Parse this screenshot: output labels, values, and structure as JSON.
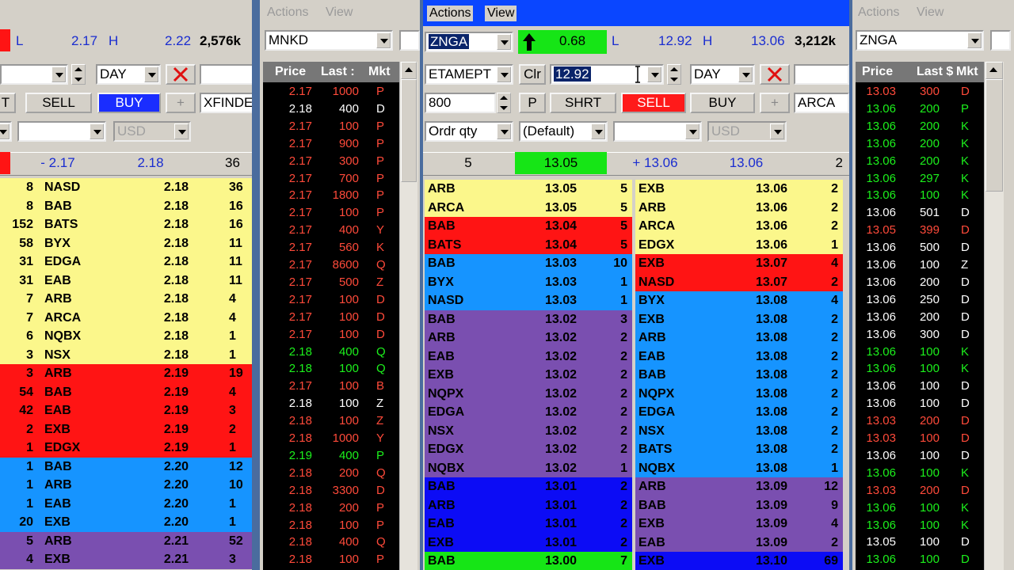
{
  "left_panel": {
    "low_label": "L",
    "low_value": "2.17",
    "high_label": "H",
    "high_value": "2.22",
    "volume": "2,576k",
    "duration": "DAY",
    "sell_label": "SELL",
    "buy_label": "BUY",
    "plus_label": "+",
    "route": "XFINDE",
    "left_btn_partial": "T",
    "currency": "USD",
    "summary": {
      "bid_change": "- 2.17",
      "ask": "2.18",
      "ask_size": "36"
    },
    "bids": [
      {
        "size": "8",
        "mm": "NASD",
        "price": "2.18",
        "ask_size": "36",
        "color": "yellow"
      },
      {
        "size": "8",
        "mm": "BAB",
        "price": "2.18",
        "ask_size": "16",
        "color": "yellow"
      },
      {
        "size": "152",
        "mm": "BATS",
        "price": "2.18",
        "ask_size": "16",
        "color": "yellow"
      },
      {
        "size": "58",
        "mm": "BYX",
        "price": "2.18",
        "ask_size": "11",
        "color": "yellow"
      },
      {
        "size": "31",
        "mm": "EDGA",
        "price": "2.18",
        "ask_size": "11",
        "color": "yellow"
      },
      {
        "size": "31",
        "mm": "EAB",
        "price": "2.18",
        "ask_size": "11",
        "color": "yellow"
      },
      {
        "size": "7",
        "mm": "ARB",
        "price": "2.18",
        "ask_size": "4",
        "color": "yellow"
      },
      {
        "size": "7",
        "mm": "ARCA",
        "price": "2.18",
        "ask_size": "4",
        "color": "yellow"
      },
      {
        "size": "6",
        "mm": "NQBX",
        "price": "2.18",
        "ask_size": "1",
        "color": "yellow"
      },
      {
        "size": "3",
        "mm": "NSX",
        "price": "2.18",
        "ask_size": "1",
        "color": "yellow"
      },
      {
        "size": "3",
        "mm": "ARB",
        "price": "2.19",
        "ask_size": "19",
        "color": "red"
      },
      {
        "size": "54",
        "mm": "BAB",
        "price": "2.19",
        "ask_size": "4",
        "color": "red"
      },
      {
        "size": "42",
        "mm": "EAB",
        "price": "2.19",
        "ask_size": "3",
        "color": "red"
      },
      {
        "size": "2",
        "mm": "EXB",
        "price": "2.19",
        "ask_size": "2",
        "color": "red"
      },
      {
        "size": "1",
        "mm": "EDGX",
        "price": "2.19",
        "ask_size": "1",
        "color": "red"
      },
      {
        "size": "1",
        "mm": "BAB",
        "price": "2.20",
        "ask_size": "12",
        "color": "blue"
      },
      {
        "size": "1",
        "mm": "ARB",
        "price": "2.20",
        "ask_size": "10",
        "color": "blue"
      },
      {
        "size": "1",
        "mm": "EAB",
        "price": "2.20",
        "ask_size": "1",
        "color": "blue"
      },
      {
        "size": "20",
        "mm": "EXB",
        "price": "2.20",
        "ask_size": "1",
        "color": "blue"
      },
      {
        "size": "5",
        "mm": "ARB",
        "price": "2.21",
        "ask_size": "52",
        "color": "purple"
      },
      {
        "size": "4",
        "mm": "EXB",
        "price": "2.21",
        "ask_size": "3",
        "color": "purple"
      }
    ]
  },
  "mnkd_tape": {
    "menu": {
      "actions": "Actions",
      "view": "View"
    },
    "symbol": "MNKD",
    "headers": {
      "price": "Price",
      "last": "Last :",
      "mkt": "Mkt"
    },
    "rows": [
      {
        "price": "2.17",
        "size": "1000",
        "mkt": "P",
        "c": "red"
      },
      {
        "price": "2.18",
        "size": "400",
        "mkt": "D",
        "c": "white"
      },
      {
        "price": "2.17",
        "size": "100",
        "mkt": "P",
        "c": "red"
      },
      {
        "price": "2.17",
        "size": "900",
        "mkt": "P",
        "c": "red"
      },
      {
        "price": "2.17",
        "size": "300",
        "mkt": "P",
        "c": "red"
      },
      {
        "price": "2.17",
        "size": "700",
        "mkt": "P",
        "c": "red"
      },
      {
        "price": "2.17",
        "size": "1800",
        "mkt": "P",
        "c": "red"
      },
      {
        "price": "2.17",
        "size": "100",
        "mkt": "P",
        "c": "red"
      },
      {
        "price": "2.17",
        "size": "400",
        "mkt": "Y",
        "c": "red"
      },
      {
        "price": "2.17",
        "size": "560",
        "mkt": "K",
        "c": "red"
      },
      {
        "price": "2.17",
        "size": "8600",
        "mkt": "Q",
        "c": "red"
      },
      {
        "price": "2.17",
        "size": "500",
        "mkt": "Z",
        "c": "red"
      },
      {
        "price": "2.17",
        "size": "100",
        "mkt": "D",
        "c": "red"
      },
      {
        "price": "2.17",
        "size": "100",
        "mkt": "D",
        "c": "red"
      },
      {
        "price": "2.17",
        "size": "100",
        "mkt": "D",
        "c": "red"
      },
      {
        "price": "2.18",
        "size": "400",
        "mkt": "Q",
        "c": "green"
      },
      {
        "price": "2.18",
        "size": "100",
        "mkt": "Q",
        "c": "green"
      },
      {
        "price": "2.17",
        "size": "100",
        "mkt": "B",
        "c": "red"
      },
      {
        "price": "2.18",
        "size": "100",
        "mkt": "Z",
        "c": "white"
      },
      {
        "price": "2.18",
        "size": "100",
        "mkt": "Z",
        "c": "red"
      },
      {
        "price": "2.18",
        "size": "1000",
        "mkt": "Y",
        "c": "red"
      },
      {
        "price": "2.19",
        "size": "400",
        "mkt": "P",
        "c": "green"
      },
      {
        "price": "2.18",
        "size": "200",
        "mkt": "Q",
        "c": "red"
      },
      {
        "price": "2.18",
        "size": "3300",
        "mkt": "D",
        "c": "red"
      },
      {
        "price": "2.18",
        "size": "200",
        "mkt": "P",
        "c": "red"
      },
      {
        "price": "2.18",
        "size": "100",
        "mkt": "P",
        "c": "red"
      },
      {
        "price": "2.18",
        "size": "400",
        "mkt": "Q",
        "c": "red"
      },
      {
        "price": "2.18",
        "size": "100",
        "mkt": "P",
        "c": "red"
      }
    ]
  },
  "znga_l2": {
    "menu": {
      "actions": "Actions",
      "view": "View"
    },
    "symbol": "ZNGA",
    "change": "0.68",
    "low_label": "L",
    "low_value": "12.92",
    "high_label": "H",
    "high_value": "13.06",
    "volume": "3,212k",
    "order_type": "ETAMEPT",
    "clr_label": "Clr",
    "price_input": "12.92",
    "duration": "DAY",
    "quantity": "800",
    "p_label": "P",
    "shrt_label": "SHRT",
    "sell_label": "SELL",
    "buy_label": "BUY",
    "plus_label": "+",
    "route": "ARCA",
    "qty_mode": "Ordr qty",
    "account": "(Default)",
    "currency": "USD",
    "summary": {
      "bid_size": "5",
      "bid": "13.05",
      "ask_change": "+ 13.06",
      "ask": "13.06",
      "ask_size": "2"
    },
    "bids": [
      {
        "mm": "ARB",
        "price": "13.05",
        "size": "5",
        "color": "yellow"
      },
      {
        "mm": "ARCA",
        "price": "13.05",
        "size": "5",
        "color": "yellow"
      },
      {
        "mm": "BAB",
        "price": "13.04",
        "size": "5",
        "color": "red"
      },
      {
        "mm": "BATS",
        "price": "13.04",
        "size": "5",
        "color": "red"
      },
      {
        "mm": "BAB",
        "price": "13.03",
        "size": "10",
        "color": "blue"
      },
      {
        "mm": "BYX",
        "price": "13.03",
        "size": "1",
        "color": "blue"
      },
      {
        "mm": "NASD",
        "price": "13.03",
        "size": "1",
        "color": "blue"
      },
      {
        "mm": "BAB",
        "price": "13.02",
        "size": "3",
        "color": "purple"
      },
      {
        "mm": "ARB",
        "price": "13.02",
        "size": "2",
        "color": "purple"
      },
      {
        "mm": "EAB",
        "price": "13.02",
        "size": "2",
        "color": "purple"
      },
      {
        "mm": "EXB",
        "price": "13.02",
        "size": "2",
        "color": "purple"
      },
      {
        "mm": "NQPX",
        "price": "13.02",
        "size": "2",
        "color": "purple"
      },
      {
        "mm": "EDGA",
        "price": "13.02",
        "size": "2",
        "color": "purple"
      },
      {
        "mm": "NSX",
        "price": "13.02",
        "size": "2",
        "color": "purple"
      },
      {
        "mm": "EDGX",
        "price": "13.02",
        "size": "2",
        "color": "purple"
      },
      {
        "mm": "NQBX",
        "price": "13.02",
        "size": "1",
        "color": "purple"
      },
      {
        "mm": "BAB",
        "price": "13.01",
        "size": "2",
        "color": "darkblue"
      },
      {
        "mm": "ARB",
        "price": "13.01",
        "size": "2",
        "color": "darkblue"
      },
      {
        "mm": "EAB",
        "price": "13.01",
        "size": "2",
        "color": "darkblue"
      },
      {
        "mm": "EXB",
        "price": "13.01",
        "size": "2",
        "color": "darkblue"
      },
      {
        "mm": "BAB",
        "price": "13.00",
        "size": "7",
        "color": "green"
      }
    ],
    "asks": [
      {
        "mm": "EXB",
        "price": "13.06",
        "size": "2",
        "color": "yellow"
      },
      {
        "mm": "ARB",
        "price": "13.06",
        "size": "2",
        "color": "yellow"
      },
      {
        "mm": "ARCA",
        "price": "13.06",
        "size": "2",
        "color": "yellow"
      },
      {
        "mm": "EDGX",
        "price": "13.06",
        "size": "1",
        "color": "yellow"
      },
      {
        "mm": "EXB",
        "price": "13.07",
        "size": "4",
        "color": "red"
      },
      {
        "mm": "NASD",
        "price": "13.07",
        "size": "2",
        "color": "red"
      },
      {
        "mm": "BYX",
        "price": "13.08",
        "size": "4",
        "color": "blue"
      },
      {
        "mm": "EXB",
        "price": "13.08",
        "size": "2",
        "color": "blue"
      },
      {
        "mm": "ARB",
        "price": "13.08",
        "size": "2",
        "color": "blue"
      },
      {
        "mm": "EAB",
        "price": "13.08",
        "size": "2",
        "color": "blue"
      },
      {
        "mm": "BAB",
        "price": "13.08",
        "size": "2",
        "color": "blue"
      },
      {
        "mm": "NQPX",
        "price": "13.08",
        "size": "2",
        "color": "blue"
      },
      {
        "mm": "EDGA",
        "price": "13.08",
        "size": "2",
        "color": "blue"
      },
      {
        "mm": "NSX",
        "price": "13.08",
        "size": "2",
        "color": "blue"
      },
      {
        "mm": "BATS",
        "price": "13.08",
        "size": "2",
        "color": "blue"
      },
      {
        "mm": "NQBX",
        "price": "13.08",
        "size": "1",
        "color": "blue"
      },
      {
        "mm": "ARB",
        "price": "13.09",
        "size": "12",
        "color": "purple"
      },
      {
        "mm": "BAB",
        "price": "13.09",
        "size": "9",
        "color": "purple"
      },
      {
        "mm": "EXB",
        "price": "13.09",
        "size": "4",
        "color": "purple"
      },
      {
        "mm": "EAB",
        "price": "13.09",
        "size": "2",
        "color": "purple"
      },
      {
        "mm": "EXB",
        "price": "13.10",
        "size": "69",
        "color": "darkblue"
      }
    ]
  },
  "znga_tape": {
    "menu": {
      "actions": "Actions",
      "view": "View"
    },
    "symbol": "ZNGA",
    "headers": {
      "price": "Price",
      "last": "Last $",
      "mkt": "Mkt"
    },
    "rows": [
      {
        "price": "13.03",
        "size": "300",
        "mkt": "D",
        "c": "red"
      },
      {
        "price": "13.06",
        "size": "200",
        "mkt": "P",
        "c": "green"
      },
      {
        "price": "13.06",
        "size": "200",
        "mkt": "K",
        "c": "green"
      },
      {
        "price": "13.06",
        "size": "200",
        "mkt": "K",
        "c": "green"
      },
      {
        "price": "13.06",
        "size": "200",
        "mkt": "K",
        "c": "green"
      },
      {
        "price": "13.06",
        "size": "297",
        "mkt": "K",
        "c": "green"
      },
      {
        "price": "13.06",
        "size": "100",
        "mkt": "K",
        "c": "green"
      },
      {
        "price": "13.06",
        "size": "501",
        "mkt": "D",
        "c": "white"
      },
      {
        "price": "13.05",
        "size": "399",
        "mkt": "D",
        "c": "red"
      },
      {
        "price": "13.06",
        "size": "500",
        "mkt": "D",
        "c": "white"
      },
      {
        "price": "13.06",
        "size": "100",
        "mkt": "Z",
        "c": "white"
      },
      {
        "price": "13.06",
        "size": "200",
        "mkt": "D",
        "c": "white"
      },
      {
        "price": "13.06",
        "size": "250",
        "mkt": "D",
        "c": "white"
      },
      {
        "price": "13.06",
        "size": "200",
        "mkt": "D",
        "c": "white"
      },
      {
        "price": "13.06",
        "size": "300",
        "mkt": "D",
        "c": "white"
      },
      {
        "price": "13.06",
        "size": "100",
        "mkt": "K",
        "c": "green"
      },
      {
        "price": "13.06",
        "size": "100",
        "mkt": "K",
        "c": "green"
      },
      {
        "price": "13.06",
        "size": "100",
        "mkt": "D",
        "c": "white"
      },
      {
        "price": "13.06",
        "size": "100",
        "mkt": "D",
        "c": "white"
      },
      {
        "price": "13.03",
        "size": "200",
        "mkt": "D",
        "c": "red"
      },
      {
        "price": "13.03",
        "size": "100",
        "mkt": "D",
        "c": "red"
      },
      {
        "price": "13.06",
        "size": "100",
        "mkt": "D",
        "c": "white"
      },
      {
        "price": "13.06",
        "size": "100",
        "mkt": "K",
        "c": "green"
      },
      {
        "price": "13.03",
        "size": "200",
        "mkt": "D",
        "c": "red"
      },
      {
        "price": "13.06",
        "size": "100",
        "mkt": "K",
        "c": "green"
      },
      {
        "price": "13.06",
        "size": "100",
        "mkt": "K",
        "c": "green"
      },
      {
        "price": "13.05",
        "size": "100",
        "mkt": "D",
        "c": "white"
      },
      {
        "price": "13.06",
        "size": "100",
        "mkt": "D",
        "c": "green"
      }
    ]
  },
  "colors": {
    "yellow": "#fbf78b",
    "red": "#ff1414",
    "blue": "#1694ff",
    "purple": "#7a4fb0",
    "darkblue": "#0c0cf5",
    "green": "#16e516",
    "tape_red": "#ff4a3a",
    "tape_green": "#1cf01c",
    "tape_white": "#ffffff",
    "accent_blue": "#1a2dd0"
  }
}
